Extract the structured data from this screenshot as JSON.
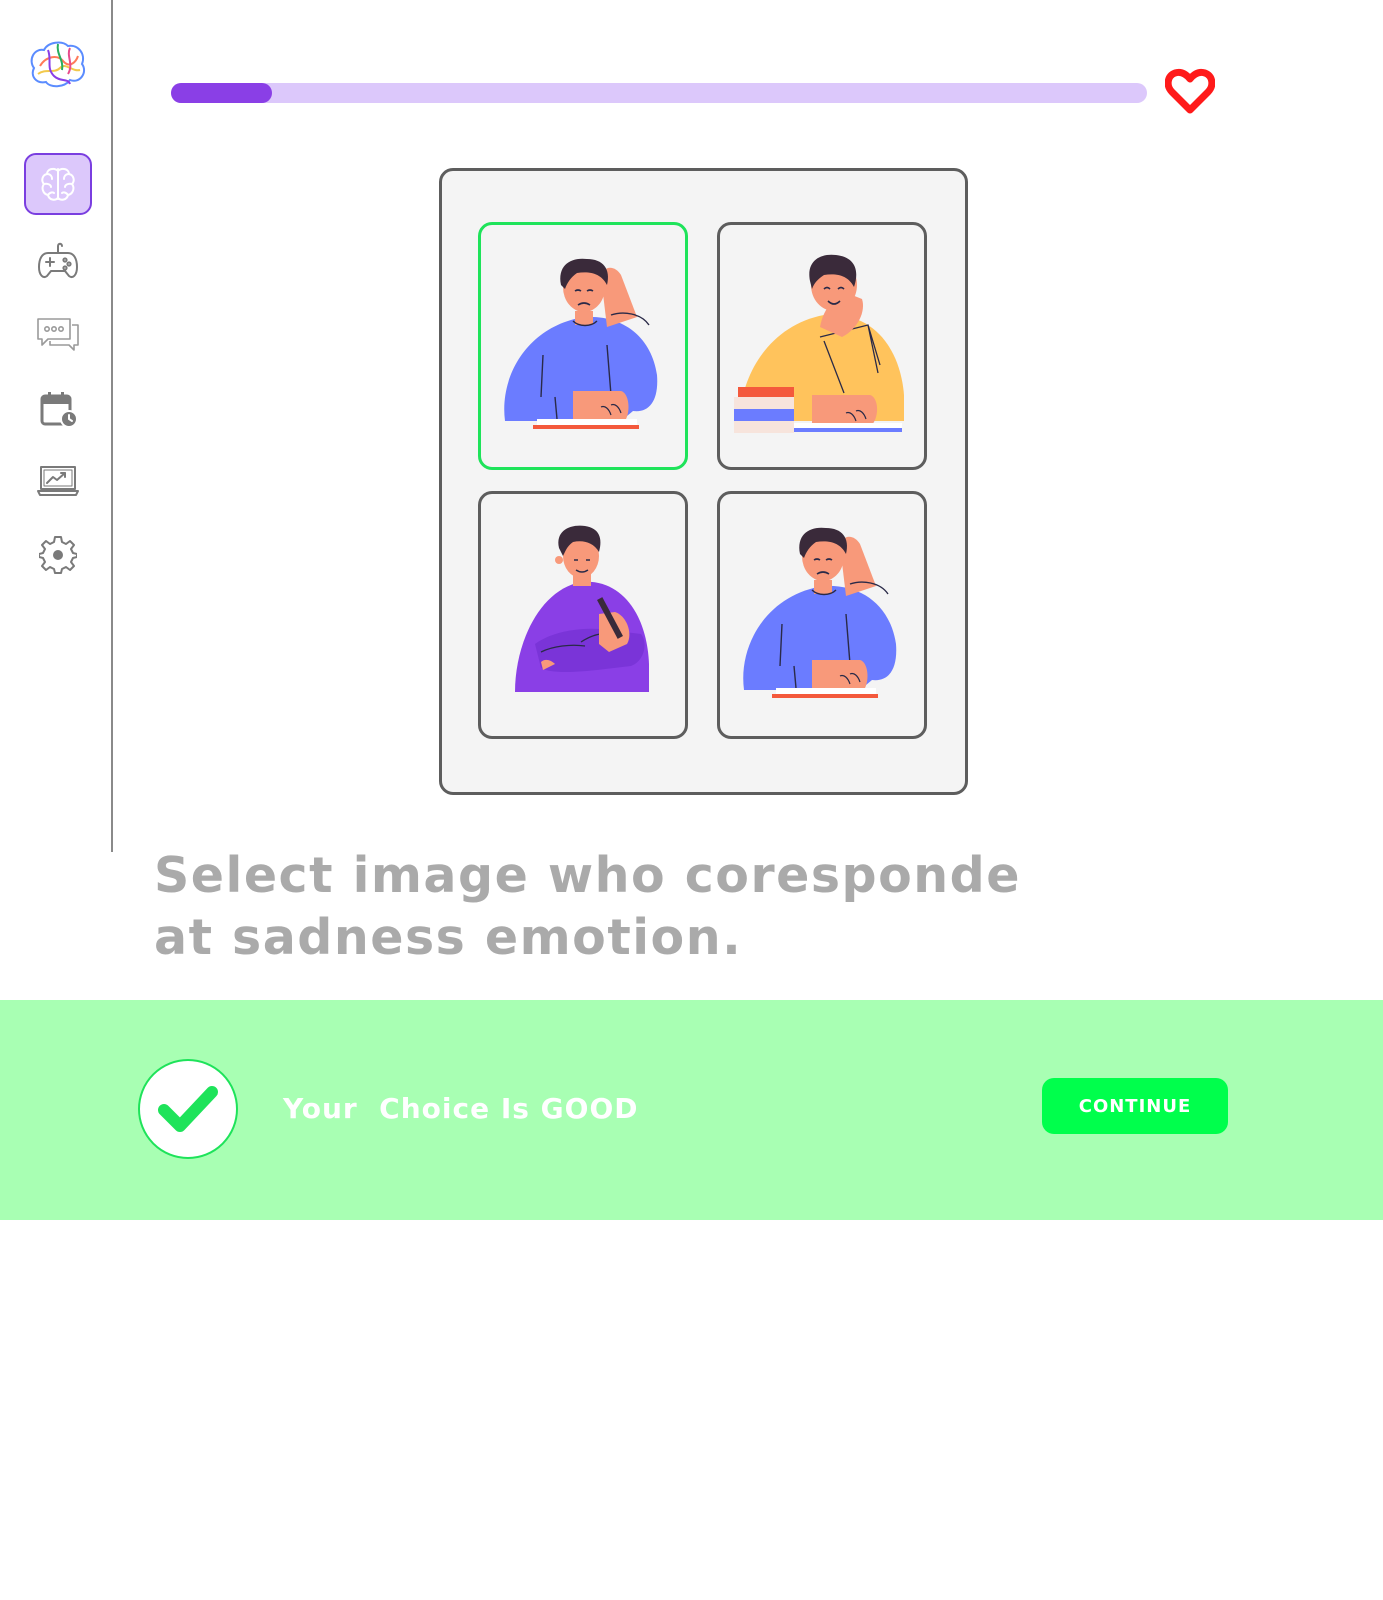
{
  "progress": {
    "value": 0.103
  },
  "colors": {
    "accent": "#8a3fe6",
    "accent_light": "#dcc8fb",
    "success": "#00ff4c",
    "success_bg": "#a8ffb3",
    "heart": "#ff1a1a",
    "question_text": "#aaaaaa"
  },
  "sidebar": {
    "logo_icon": "brain-logo",
    "items": [
      {
        "icon": "brain-icon",
        "active": true
      },
      {
        "icon": "gamepad-icon",
        "active": false
      },
      {
        "icon": "chat-icon",
        "active": false
      },
      {
        "icon": "calendar-clock-icon",
        "active": false
      },
      {
        "icon": "analytics-laptop-icon",
        "active": false
      },
      {
        "icon": "gear-icon",
        "active": false
      }
    ]
  },
  "lives_icon": "heart-icon",
  "question": {
    "line1": "Select image who coresponde",
    "line2": "at sadness emotion."
  },
  "options": [
    {
      "emotion": "sad",
      "shirt_color": "#6b7cff",
      "selected": true
    },
    {
      "emotion": "happy",
      "shirt_color": "#ffc35c",
      "selected": false
    },
    {
      "emotion": "calm",
      "shirt_color": "#8a3fe6",
      "selected": false
    },
    {
      "emotion": "sad",
      "shirt_color": "#6b7cff",
      "selected": false
    }
  ],
  "feedback": {
    "icon": "checkmark-icon",
    "message": "Your  Choice Is GOOD",
    "continue_label": "CONTINUE"
  }
}
